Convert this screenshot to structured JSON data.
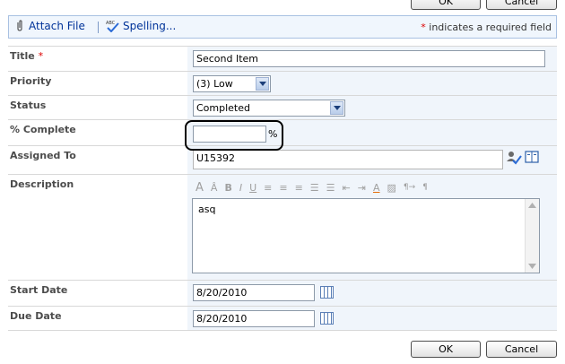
{
  "buttons": {
    "ok": "OK",
    "cancel": "Cancel"
  },
  "toolbar": {
    "attach_file": "Attach File",
    "spelling": "Spelling...",
    "required_star": "*",
    "required_note": " indicates a required field"
  },
  "fields": {
    "title": {
      "label": "Title",
      "required": "*",
      "value": "Second Item"
    },
    "priority": {
      "label": "Priority",
      "value": "(3) Low"
    },
    "status": {
      "label": "Status",
      "value": "Completed"
    },
    "percent_complete": {
      "label": "% Complete",
      "value": "",
      "suffix": "%"
    },
    "assigned_to": {
      "label": "Assigned To",
      "value": "U15392"
    },
    "description": {
      "label": "Description",
      "value": "asq"
    },
    "start_date": {
      "label": "Start Date",
      "value": "8/20/2010"
    },
    "due_date": {
      "label": "Due Date",
      "value": "8/20/2010"
    }
  },
  "rte_tools": [
    "A",
    "Â",
    "B",
    "I",
    "U",
    "≡",
    "≡",
    "≡",
    "☰",
    "☰",
    "⇤",
    "⇥",
    "A",
    "▨",
    "¶→",
    "¶"
  ],
  "colors": {
    "link": "#003399",
    "required": "#dd0000",
    "value_bg": "#f0f5fb"
  }
}
